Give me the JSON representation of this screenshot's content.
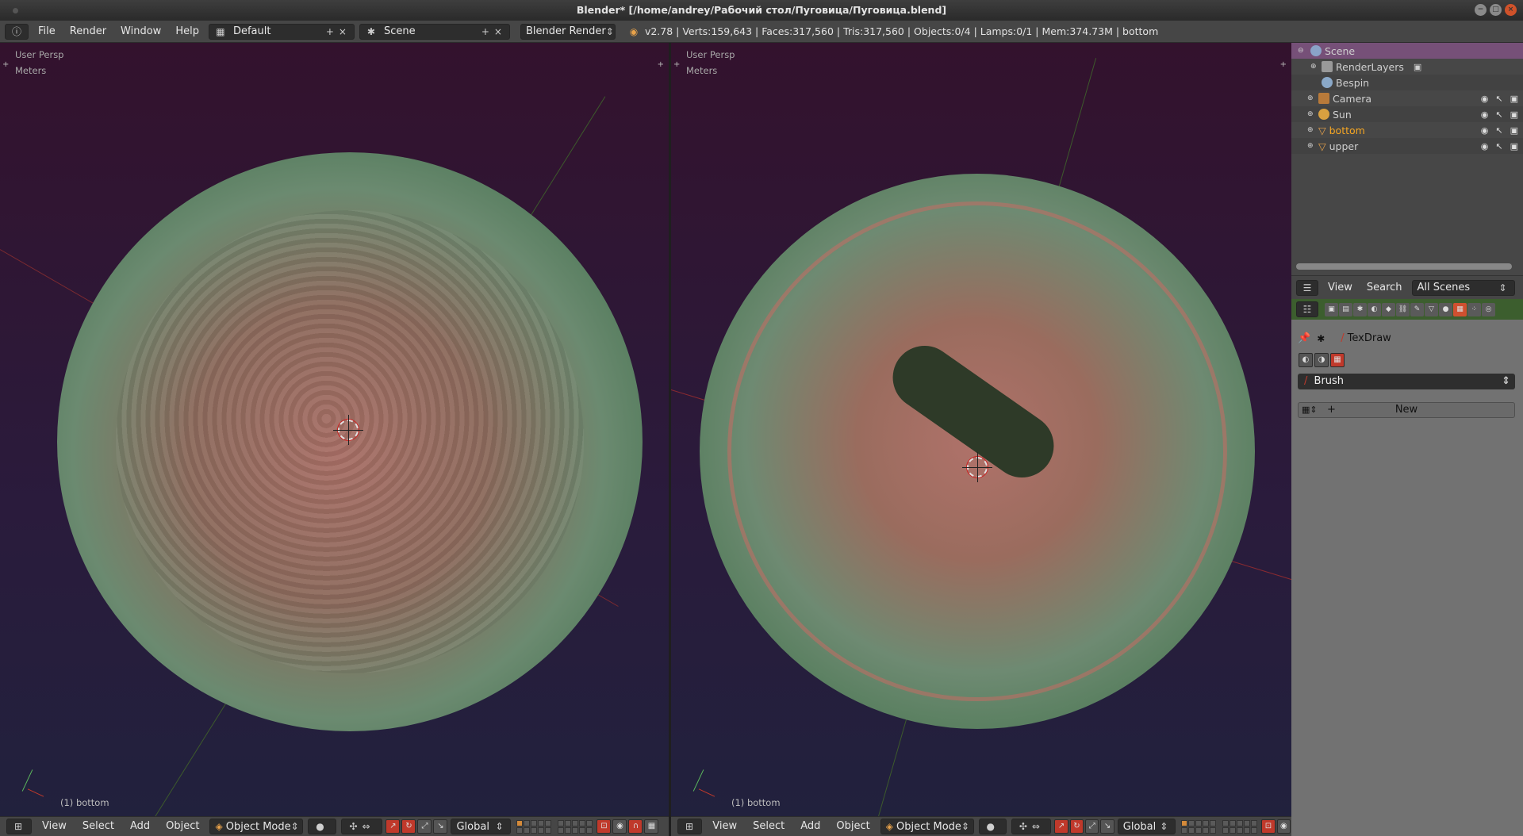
{
  "window": {
    "title": "Blender* [/home/andrey/Рабочий стол/Пуговица/Пуговица.blend]"
  },
  "menu": {
    "items": [
      "File",
      "Render",
      "Window",
      "Help"
    ]
  },
  "layout": {
    "name": "Default"
  },
  "scene": {
    "name": "Scene"
  },
  "engine": {
    "name": "Blender Render"
  },
  "stats": "v2.78 | Verts:159,643 | Faces:317,560 | Tris:317,560 | Objects:0/4 | Lamps:0/1 | Mem:374.73M | bottom",
  "viewports": [
    {
      "persp": "User Persp",
      "units": "Meters",
      "status": "(1) bottom"
    },
    {
      "persp": "User Persp",
      "units": "Meters",
      "status": "(1) bottom"
    }
  ],
  "bottom_bar": {
    "menus": [
      "View",
      "Select",
      "Add",
      "Object"
    ],
    "mode": "Object Mode",
    "orientation": "Global"
  },
  "outliner": {
    "items": [
      {
        "label": "Scene",
        "icon": "scene-icon"
      },
      {
        "label": "RenderLayers",
        "icon": "renderlayers-icon"
      },
      {
        "label": "Bespin",
        "icon": "world-icon"
      },
      {
        "label": "Camera",
        "icon": "camera-icon"
      },
      {
        "label": "Sun",
        "icon": "lamp-icon"
      },
      {
        "label": "bottom",
        "icon": "mesh-icon"
      },
      {
        "label": "upper",
        "icon": "mesh-icon"
      }
    ],
    "header": {
      "view": "View",
      "search": "Search",
      "filter": "All Scenes"
    }
  },
  "properties": {
    "texture_name": "TexDraw",
    "brush_label": "Brush",
    "new_button": "New"
  },
  "colors": {
    "accent": "#c0392b",
    "selection": "#765078",
    "highlight_text": "#f5a623"
  }
}
